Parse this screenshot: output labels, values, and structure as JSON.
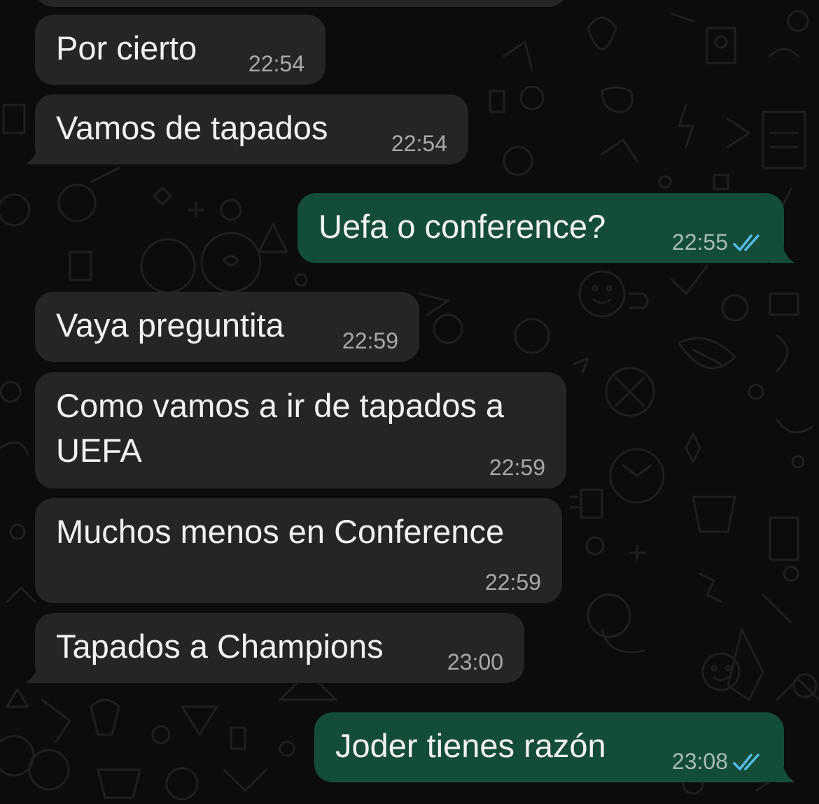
{
  "messages": [
    {
      "text": "Por cierto",
      "time": "22:54"
    },
    {
      "text": "Vamos de tapados",
      "time": "22:54"
    },
    {
      "text": "Uefa o conference?",
      "time": "22:55"
    },
    {
      "text": "Vaya preguntita",
      "time": "22:59"
    },
    {
      "text_line1": "Como vamos a ir de tapados a",
      "text_line2": "UEFA",
      "time": "22:59"
    },
    {
      "text": "Muchos menos en Conference",
      "time": "22:59"
    },
    {
      "text": "Tapados a Champions",
      "time": "23:00"
    },
    {
      "text": "Joder tienes razón",
      "time": "23:08"
    }
  ],
  "colors": {
    "background": "#0c0c0c",
    "incoming_bubble": "#242626",
    "outgoing_bubble": "#144d37",
    "read_ticks": "#53bdeb"
  },
  "icons": {
    "read_receipt": "double-check-icon"
  }
}
